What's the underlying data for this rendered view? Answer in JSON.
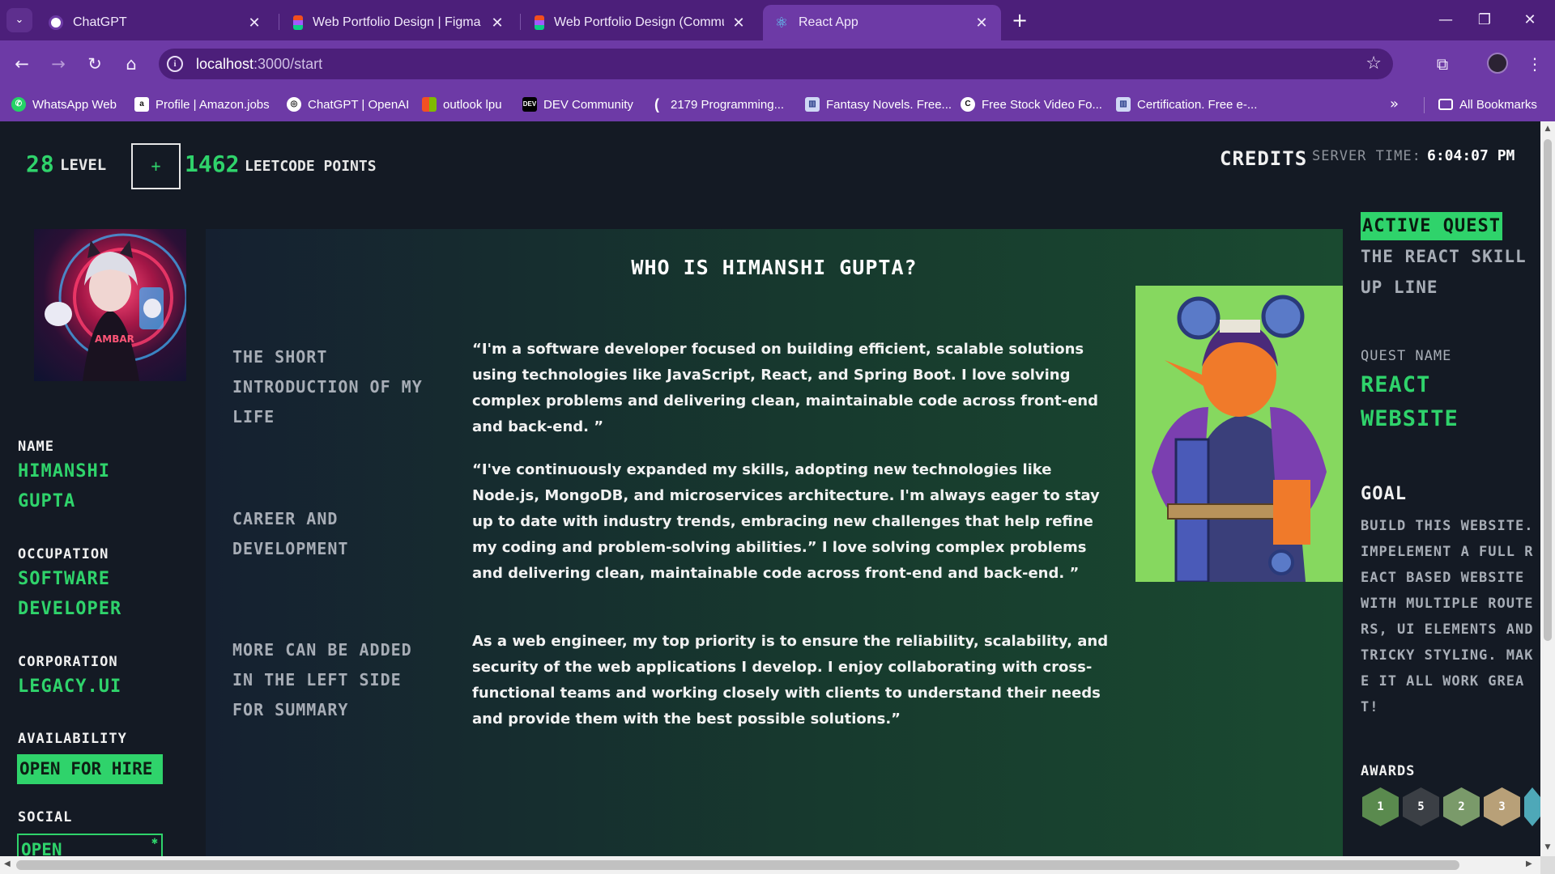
{
  "browser": {
    "tabs": [
      {
        "title": "ChatGPT",
        "favicon": "chatgpt-icon",
        "active": false
      },
      {
        "title": "Web Portfolio Design | Figma",
        "favicon": "figma-icon",
        "active": false
      },
      {
        "title": "Web Portfolio Design (Commun",
        "favicon": "figma-icon",
        "active": false
      },
      {
        "title": "React App",
        "favicon": "react-icon",
        "active": true
      }
    ],
    "url_host": "localhost",
    "url_path": ":3000/start",
    "bookmarks": [
      {
        "label": "WhatsApp Web",
        "icon": "whatsapp-icon"
      },
      {
        "label": "Profile | Amazon.jobs",
        "icon": "amazon-icon"
      },
      {
        "label": "ChatGPT | OpenAI",
        "icon": "openai-icon"
      },
      {
        "label": "outlook lpu",
        "icon": "microsoft-icon"
      },
      {
        "label": "DEV Community",
        "icon": "dev-icon"
      },
      {
        "label": "2179 Programming...",
        "icon": "bracket-icon"
      },
      {
        "label": "Fantasy Novels. Free...",
        "icon": "book-icon"
      },
      {
        "label": "Free Stock Video Fo...",
        "icon": "video-icon"
      },
      {
        "label": "Certification. Free e-...",
        "icon": "certificate-icon"
      }
    ],
    "all_bookmarks_label": "All Bookmarks",
    "colors": {
      "tabstrip": "#4c1f7a",
      "toolbar": "#6d3aa6"
    }
  },
  "hud": {
    "level_value": "28",
    "level_label": "Level",
    "plus_label": "+",
    "points_value": "1462",
    "points_label": "Leetcode Points",
    "credits_label": "CREDITS",
    "server_time_label": "SERVER TIME:",
    "server_time": "6:04:07 PM"
  },
  "sidebar": {
    "name_label": "NAME",
    "name_value": "HIMANSHI GUPTA",
    "occupation_label": "OCCUPATION",
    "occupation_value": "SOFTWARE DEVELOPER",
    "corporation_label": "CORPORATION",
    "corporation_value": "LEGACY.UI",
    "availability_label": "AVAILABILITY",
    "availability_value": "OPEN FOR HIRE",
    "social_label": "SOCIAL",
    "social_button": "OPEN"
  },
  "bio": {
    "title": "WHO IS HIMANSHI GUPTA?",
    "side_1": "The short introduction of my life",
    "side_2": "Career and development",
    "side_3": "More can be added in the left side for summary",
    "para_1": "“I'm a software developer focused on building efficient, scalable solutions using technologies like JavaScript, React, and Spring Boot. I love solving complex problems and delivering clean, maintainable code across front-end and back-end. ”",
    "para_2": "“I've continuously expanded my skills, adopting new technologies like Node.js, MongoDB, and microservices architecture. I'm always eager to stay up to date with industry trends, embracing new challenges that help refine my coding and problem-solving abilities.” I love solving complex problems and delivering clean, maintainable code across front-end and back-end. ”",
    "para_3": "As a web engineer, my top priority is to ensure the reliability, scalability, and security of the web applications I develop. I enjoy collaborating with cross-functional teams and working closely with clients to understand their needs and provide them with the best possible solutions.”"
  },
  "quest": {
    "badge": "ACTIVE QUEST",
    "title_line_1": "THE REACT SKILL",
    "title_line_2": "UP LINE",
    "name_label": "QUEST NAME",
    "name_value": "REACT WEBSITE",
    "goal_label": "GOAL",
    "goal_text": "BUILD THIS WEBSITE.IMPELEMENT A FULL REACT BASED WEBSITE WITH MULTIPLE ROUTERS, UI ELEMENTS AND TRICKY STYLING. MAKE IT ALL WORK GREAT!",
    "awards_label": "AWARDS",
    "awards": [
      {
        "label": "1",
        "color": "#5a8a4e"
      },
      {
        "label": "5",
        "color": "#3b3f45"
      },
      {
        "label": "2",
        "color": "#7a9a6a"
      },
      {
        "label": "3",
        "color": "#b8a078"
      },
      {
        "label": "",
        "color": "#4ea8b8"
      }
    ]
  },
  "theme": {
    "accent": "#2fd36b",
    "background": "#141a24",
    "muted": "#a7adb6"
  }
}
